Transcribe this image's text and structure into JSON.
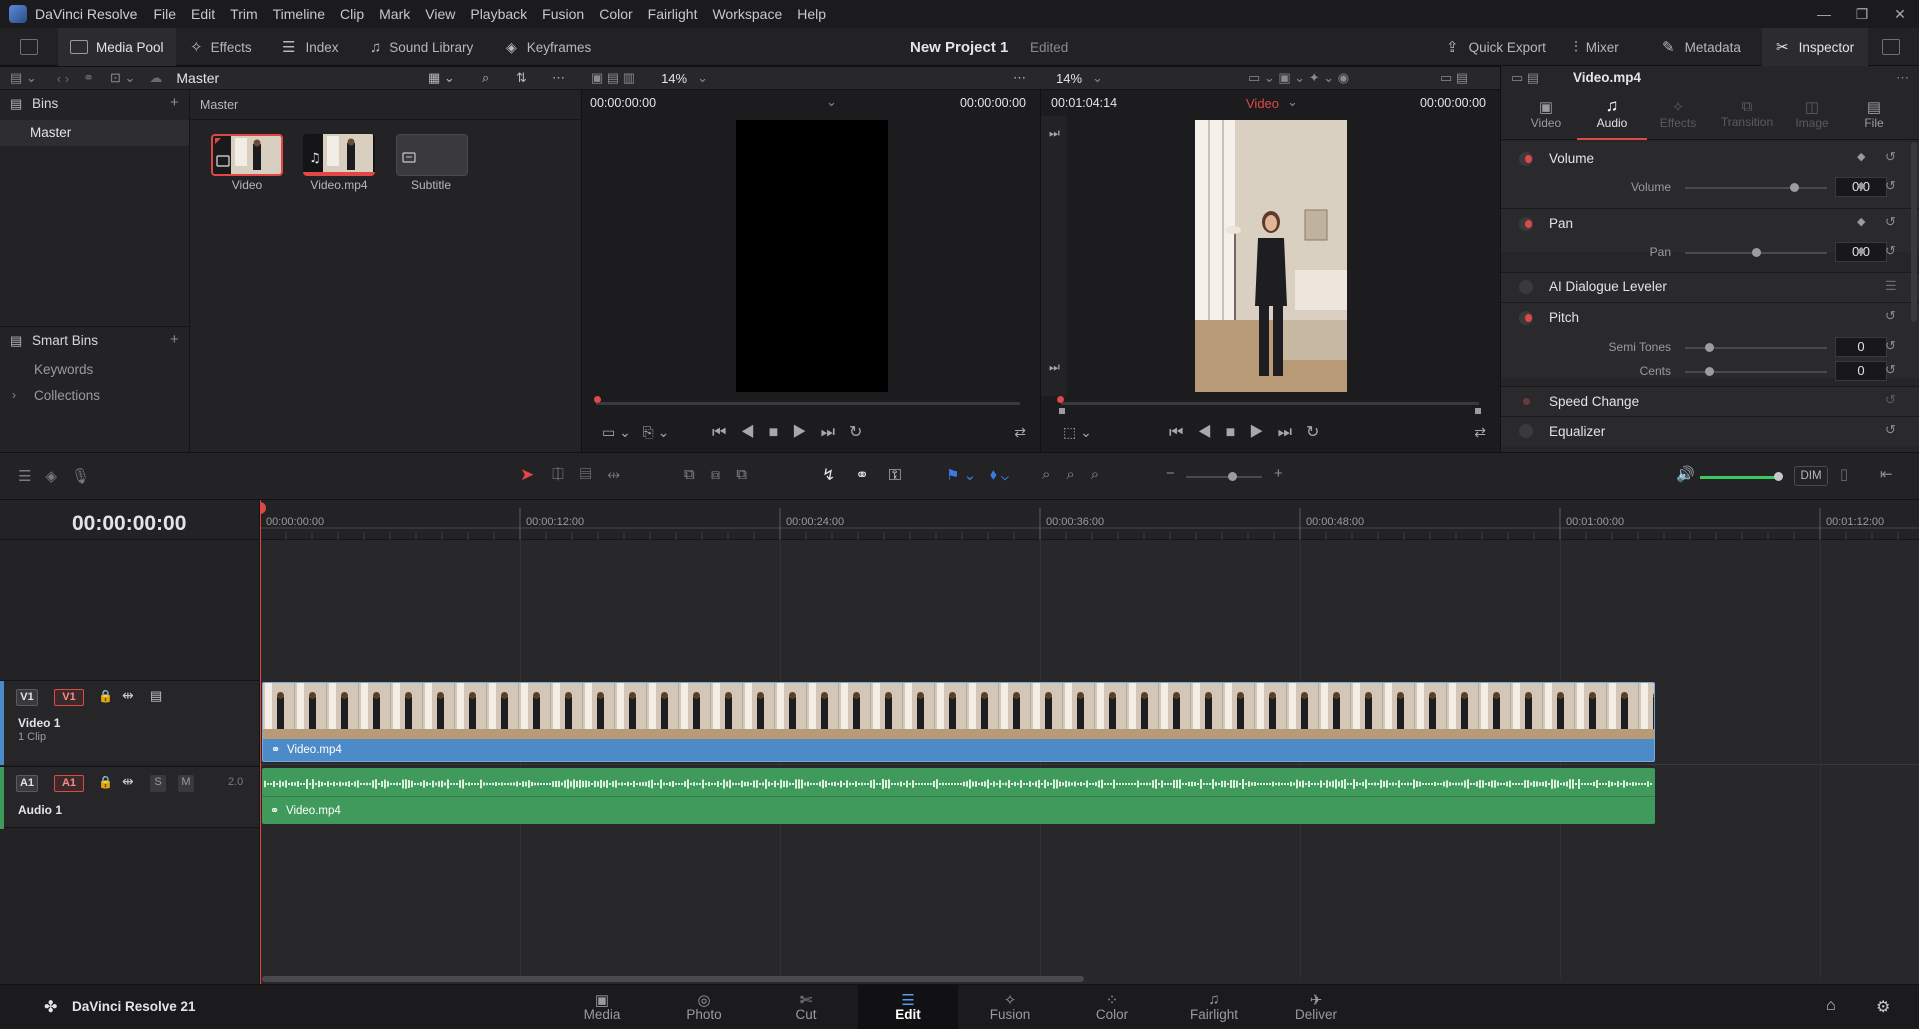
{
  "app": {
    "name": "DaVinci Resolve",
    "menu": [
      "File",
      "Edit",
      "Trim",
      "Timeline",
      "Clip",
      "Mark",
      "View",
      "Playback",
      "Fusion",
      "Color",
      "Fairlight",
      "Workspace",
      "Help"
    ]
  },
  "toolbar": {
    "media_pool": "Media Pool",
    "effects": "Effects",
    "index": "Index",
    "sound_library": "Sound Library",
    "keyframes": "Keyframes",
    "project_title": "New Project 1",
    "project_status": "Edited",
    "quick_export": "Quick Export",
    "mixer": "Mixer",
    "metadata": "Metadata",
    "inspector": "Inspector"
  },
  "bins": {
    "header": "Bins",
    "master": "Master",
    "smart_bins": "Smart Bins",
    "keywords": "Keywords",
    "collections": "Collections"
  },
  "media_pool": {
    "path": "Master",
    "breadcrumb": "Master",
    "clips": [
      {
        "label": "Video"
      },
      {
        "label": "Video.mp4"
      },
      {
        "label": "Subtitle"
      }
    ]
  },
  "source_viewer": {
    "zoom": "14%",
    "timecode_left": "00:00:00:00",
    "timecode_right": "00:00:00:00"
  },
  "record_viewer": {
    "zoom": "14%",
    "timecode_left": "00:01:04:14",
    "source": "Video",
    "timecode_right": "00:00:00:00"
  },
  "inspector": {
    "clip_name": "Video.mp4",
    "tabs": [
      "Video",
      "Audio",
      "Effects",
      "Transition",
      "Image",
      "File"
    ],
    "active_tab": "Audio",
    "volume": {
      "title": "Volume",
      "label": "Volume",
      "value": "0.0",
      "level": 0.77
    },
    "pan": {
      "title": "Pan",
      "label": "Pan",
      "value": "0.0",
      "level": 0.5
    },
    "ai_dialogue": "AI Dialogue Leveler",
    "pitch": {
      "title": "Pitch",
      "semi_label": "Semi Tones",
      "semi_value": "0",
      "cents_label": "Cents",
      "cents_value": "0"
    },
    "speed_change": "Speed Change",
    "equalizer": "Equalizer"
  },
  "timeline": {
    "timecode": "00:00:00:00",
    "ruler": [
      "00:00:00:00",
      "00:00:12:00",
      "00:00:24:00",
      "00:00:36:00",
      "00:00:48:00",
      "00:01:00:00",
      "00:01:12:00"
    ],
    "dim": "DIM",
    "tracks": {
      "v1_badge": "V1",
      "v1_badge2": "V1",
      "v1_name": "Video 1",
      "v1_clips": "1 Clip",
      "a1_badge": "A1",
      "a1_badge2": "A1",
      "a1_name": "Audio 1",
      "a1_solo": "S",
      "a1_mute": "M",
      "a1_channels": "2.0"
    },
    "video_clip": "Video.mp4",
    "audio_clip": "Video.mp4"
  },
  "footer": {
    "brand": "DaVinci Resolve 21",
    "pages": [
      "Media",
      "Photo",
      "Cut",
      "Edit",
      "Fusion",
      "Color",
      "Fairlight",
      "Deliver"
    ],
    "active_page": "Edit"
  },
  "colors": {
    "accent_red": "#e04848",
    "video_clip": "#4d8ac8",
    "audio_clip": "#3f9a5c",
    "active_blue": "#5b9bf0"
  }
}
